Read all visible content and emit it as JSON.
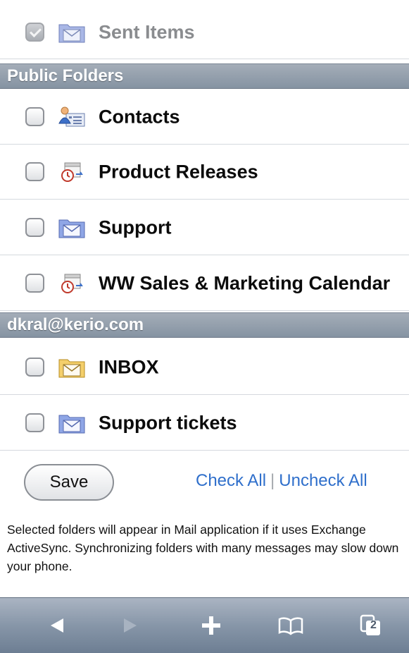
{
  "sections": [
    {
      "header": "",
      "items": [
        {
          "label": "Sent Items",
          "checked": true,
          "dimmed": true,
          "icon": "mail-folder-icon"
        }
      ]
    },
    {
      "header": "Public Folders",
      "items": [
        {
          "label": "Contacts",
          "checked": false,
          "icon": "contacts-folder-icon"
        },
        {
          "label": "Product Releases",
          "checked": false,
          "icon": "calendar-folder-icon"
        },
        {
          "label": "Support",
          "checked": false,
          "icon": "mail-folder-icon"
        },
        {
          "label": "WW Sales & Marketing Calendar",
          "checked": false,
          "icon": "calendar-folder-icon"
        }
      ]
    },
    {
      "header": "dkral@kerio.com",
      "items": [
        {
          "label": "INBOX",
          "checked": false,
          "icon": "inbox-folder-icon"
        },
        {
          "label": "Support tickets",
          "checked": false,
          "icon": "mail-folder-icon"
        }
      ]
    }
  ],
  "actions": {
    "save_label": "Save",
    "check_all_label": "Check All",
    "separator": "|",
    "uncheck_all_label": "Uncheck All"
  },
  "note": "Selected folders will appear in Mail application if it uses Exchange ActiveSync. Synchronizing folders with many messages may slow down your phone.",
  "toolbar": {
    "buttons": [
      "back-arrow-icon",
      "forward-arrow-icon",
      "plus-icon",
      "bookmarks-icon",
      "pages-icon"
    ],
    "pages_count": "2"
  }
}
